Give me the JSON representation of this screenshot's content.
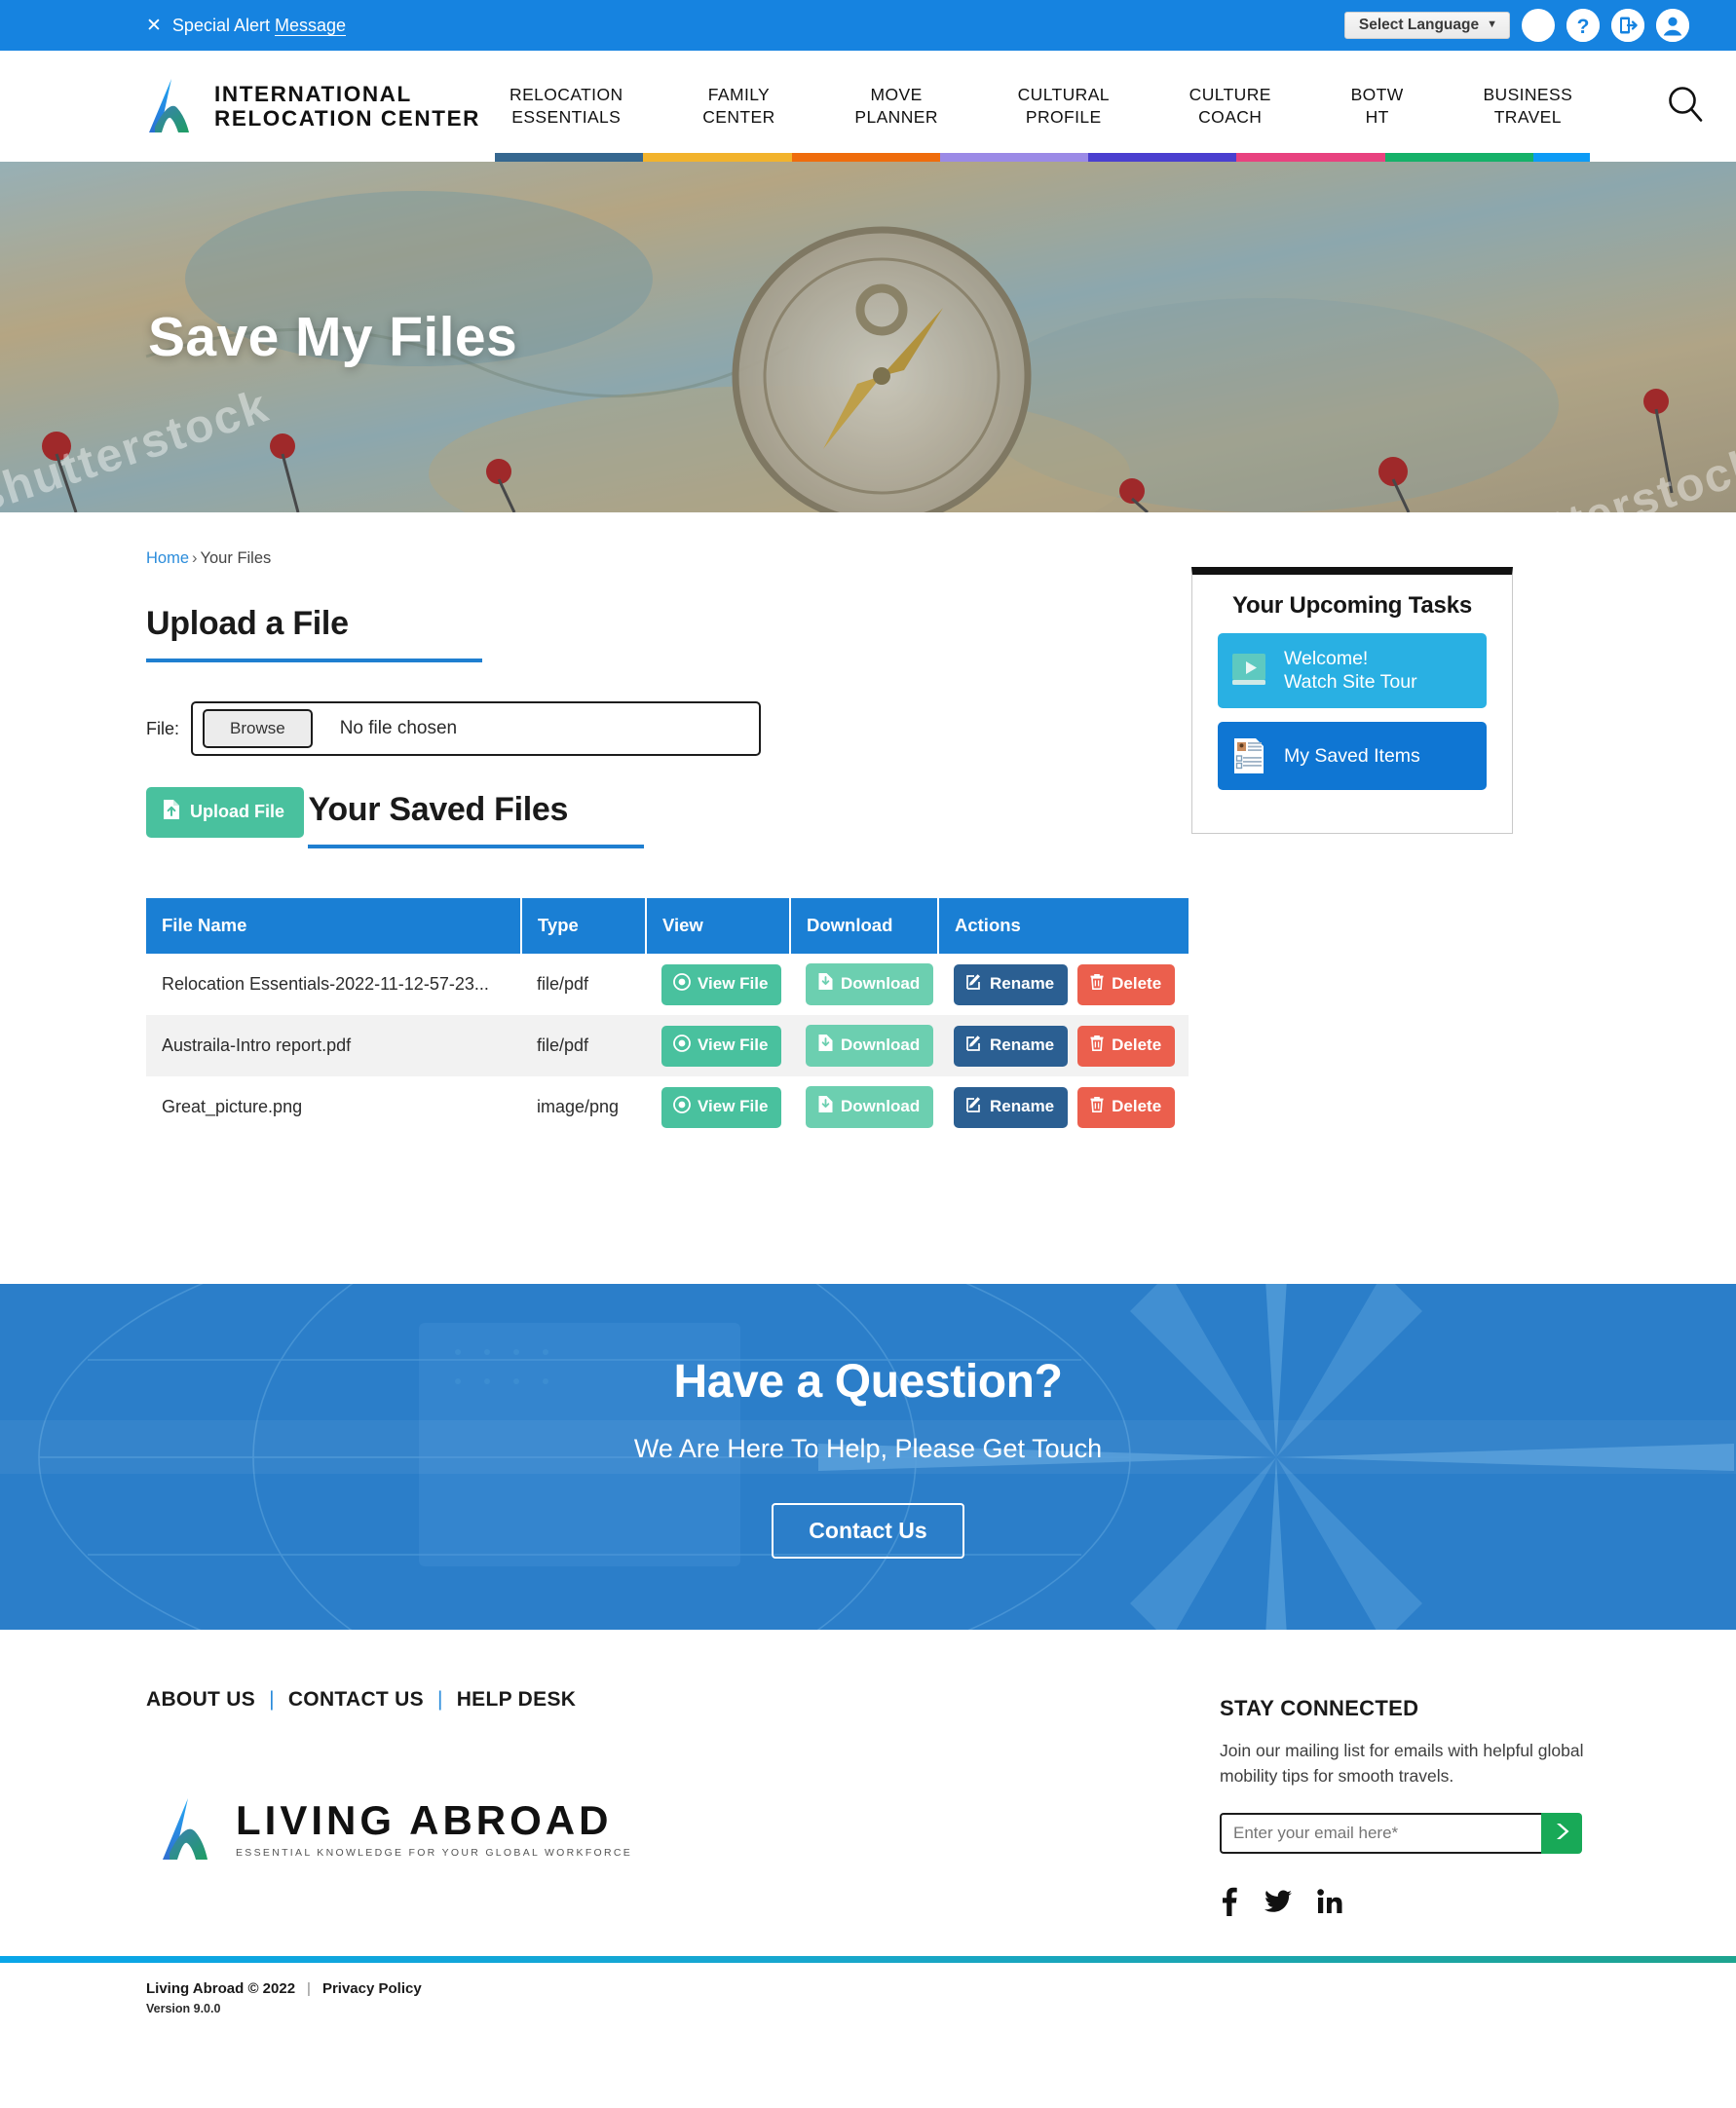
{
  "alert": {
    "close_icon": "close-icon",
    "text": "Special Alert ",
    "underlined": "Message",
    "language_label": "Select Language",
    "chevron": "⌄",
    "icons": [
      "accessibility-icon",
      "help-icon",
      "logout-icon",
      "user-account-icon"
    ]
  },
  "header": {
    "logo_line1": "INTERNATIONAL",
    "logo_line2": "RELOCATION CENTER",
    "nav": [
      {
        "line1": "RELOCATION",
        "line2": "ESSENTIALS",
        "color": "#36678f"
      },
      {
        "line1": "FAMILY",
        "line2": "CENTER",
        "color": "#f2b32c"
      },
      {
        "line1": "MOVE",
        "line2": "PLANNER",
        "color": "#ef6c0c"
      },
      {
        "line1": "CULTURAL",
        "line2": "PROFILE",
        "color": "#9b8ae6"
      },
      {
        "line1": "CULTURE",
        "line2": "COACH",
        "color": "#4a3fcf"
      },
      {
        "line1": "BOTW",
        "line2": "HT",
        "color": "#e8427f"
      },
      {
        "line1": "BUSINESS",
        "line2": "TRAVEL",
        "color": "#16b169"
      },
      {
        "line1": "",
        "line2": "",
        "color": "#0d9bf5"
      }
    ],
    "search_icon": "search-icon"
  },
  "hero": {
    "title": "Save My Files",
    "watermark": "shutterstock"
  },
  "breadcrumb": {
    "home": "Home",
    "separator": "›",
    "current": "Your Files"
  },
  "upload": {
    "heading": "Upload a File",
    "file_label": "File:",
    "browse_label": "Browse",
    "no_file_text": "No file chosen",
    "upload_button": "Upload File",
    "upload_icon": "file-upload-icon"
  },
  "saved": {
    "heading": "Your Saved Files",
    "columns": [
      "File Name",
      "Type",
      "View",
      "Download",
      "Actions"
    ],
    "rows": [
      {
        "name": "Relocation Essentials-2022-11-12-57-23...",
        "type": "file/pdf",
        "view": "View File",
        "download": "Download",
        "rename": "Rename",
        "delete": "Delete"
      },
      {
        "name": "Austraila-Intro report.pdf",
        "type": "file/pdf",
        "view": "View File",
        "download": "Download",
        "rename": "Rename",
        "delete": "Delete"
      },
      {
        "name": "Great_picture.png",
        "type": "image/png",
        "view": "View File",
        "download": "Download",
        "rename": "Rename",
        "delete": "Delete"
      }
    ]
  },
  "tasks": {
    "title": "Your Upcoming Tasks",
    "items": [
      {
        "line1": "Welcome!",
        "line2": "Watch Site Tour",
        "icon": "video-play-icon",
        "color": "#29b0e3"
      },
      {
        "line1": "My Saved Items",
        "line2": "",
        "icon": "saved-document-icon",
        "color": "#0f76d3"
      }
    ]
  },
  "cta": {
    "heading": "Have a Question?",
    "subheading": "We Are Here To Help, Please Get Touch",
    "button": "Contact Us"
  },
  "footer": {
    "links": [
      "ABOUT US",
      "CONTACT US",
      "HELP DESK"
    ],
    "divider": "|",
    "logo_big": "LIVING ABROAD",
    "logo_tagline": "ESSENTIAL KNOWLEDGE FOR YOUR GLOBAL WORKFORCE",
    "stay_connected": "STAY CONNECTED",
    "mailing_copy": "Join our mailing list for emails with helpful global mobility tips for smooth travels.",
    "email_placeholder": "Enter your email here*",
    "submit_icon": "chevron-right-icon",
    "socials": [
      "facebook-icon",
      "twitter-icon",
      "linkedin-icon"
    ]
  },
  "bottom": {
    "copyright": "Living Abroad  © 2022",
    "pipe": "|",
    "privacy": "Privacy Policy",
    "version": "Version 9.0.0"
  },
  "colors": {
    "brand_blue": "#1683e0",
    "table_header": "#1a7fd4",
    "accent_green": "#49c19e",
    "danger_red": "#eb5f4d",
    "rename_blue": "#2b5f92"
  }
}
